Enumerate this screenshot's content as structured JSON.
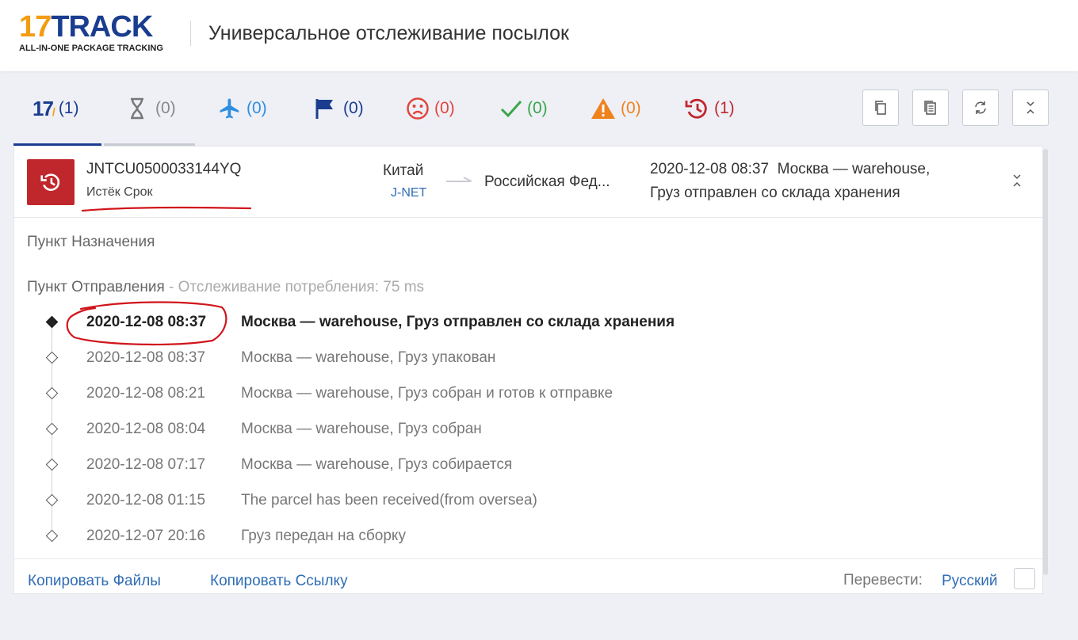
{
  "header": {
    "logo_main": "17TRACK",
    "logo_sub": "ALL-IN-ONE PACKAGE TRACKING",
    "title": "Универсальное отслеживание посылок"
  },
  "tabs": [
    {
      "icon": "17track-logo-icon",
      "count": "(1)",
      "color": "#1b3d8f"
    },
    {
      "icon": "hourglass-icon",
      "count": "(0)",
      "color": "#888888"
    },
    {
      "icon": "airplane-icon",
      "count": "(0)",
      "color": "#2f8ee0"
    },
    {
      "icon": "flag-icon",
      "count": "(0)",
      "color": "#1b3d8f"
    },
    {
      "icon": "sad-face-icon",
      "count": "(0)",
      "color": "#e0463d"
    },
    {
      "icon": "checkmark-icon",
      "count": "(0)",
      "color": "#3aa54a"
    },
    {
      "icon": "warning-icon",
      "count": "(0)",
      "color": "#f0821e"
    },
    {
      "icon": "expired-history-icon",
      "count": "(1)",
      "color": "#c0272d"
    }
  ],
  "toolbar": [
    {
      "icon": "copy-icon"
    },
    {
      "icon": "document-icon"
    },
    {
      "icon": "refresh-icon"
    },
    {
      "icon": "collapse-icon"
    }
  ],
  "shipment": {
    "tracking_number": "JNTCU0500033144YQ",
    "status": "Истёк Срок",
    "origin": "Китай",
    "carrier": "J-NET",
    "destination": "Российская Фед...",
    "latest_line1": "2020-12-08 08:37  Москва — warehouse,",
    "latest_line2": "Груз отправлен со склада хранения"
  },
  "details": {
    "destination_label": "Пункт Назначения",
    "origin_label": "Пункт Отправления",
    "origin_meta": " - Отслеживание потребления: 75 ms"
  },
  "events": [
    {
      "date": "2020-12-08 08:37",
      "desc": "Москва — warehouse, Груз отправлен со склада хранения"
    },
    {
      "date": "2020-12-08 08:37",
      "desc": "Москва — warehouse, Груз упакован"
    },
    {
      "date": "2020-12-08 08:21",
      "desc": "Москва — warehouse, Груз собран и готов к отправке"
    },
    {
      "date": "2020-12-08 08:04",
      "desc": "Москва — warehouse, Груз собран"
    },
    {
      "date": "2020-12-08 07:17",
      "desc": "Москва — warehouse, Груз собирается"
    },
    {
      "date": "2020-12-08 01:15",
      "desc": "The parcel has been received(from oversea)"
    },
    {
      "date": "2020-12-07 20:16",
      "desc": "Груз передан на сборку"
    }
  ],
  "footer": {
    "copy_files": "Копировать Файлы",
    "copy_link": "Копировать Ссылку",
    "translate_label": "Перевести:",
    "language": "Русский"
  },
  "colors": {
    "brand_blue": "#1b3d8f",
    "brand_orange": "#f39c12",
    "expired_red": "#c0272d",
    "link_blue": "#2f6db5",
    "annotation_red": "#d0151b"
  }
}
